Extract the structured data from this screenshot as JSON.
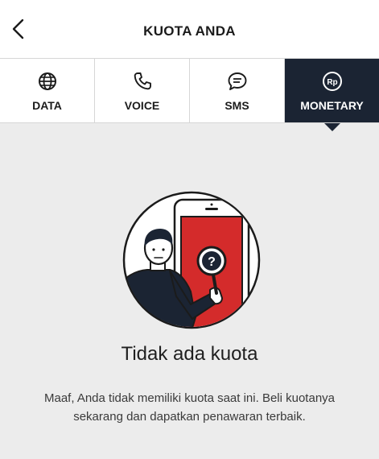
{
  "header": {
    "title": "KUOTA ANDA",
    "back_icon": "chevron-left-icon"
  },
  "tabs": [
    {
      "label": "DATA",
      "icon": "globe-icon",
      "active": false
    },
    {
      "label": "VOICE",
      "icon": "phone-icon",
      "active": false
    },
    {
      "label": "SMS",
      "icon": "chat-bubble-icon",
      "active": false
    },
    {
      "label": "MONETARY",
      "icon": "rupiah-coin-icon",
      "active": true
    }
  ],
  "coin_symbol": "Rp",
  "empty_state": {
    "title": "Tidak ada kuota",
    "description": "Maaf, Anda tidak memiliki kuota saat ini. Beli kuotanya sekarang dan dapatkan penawaran terbaik.",
    "illustration": "person-with-phone-question-illustration"
  },
  "colors": {
    "active_tab": "#1b2433",
    "phone_screen": "#d42b2b",
    "background": "#ececec"
  }
}
